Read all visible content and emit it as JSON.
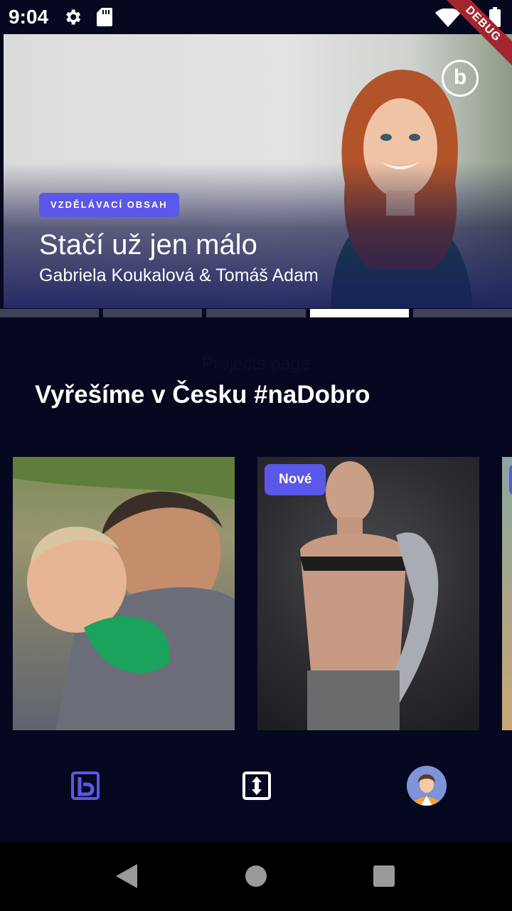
{
  "status_bar": {
    "time": "9:04",
    "debug_label": "DEBUG",
    "icons": [
      "gear-icon",
      "sd-card-icon",
      "wifi-icon",
      "battery-icon"
    ]
  },
  "hero": {
    "tag": "VZDĚLÁVACÍ OBSAH",
    "title": "Stačí už jen málo",
    "subtitle": "Gabriela Koukalová & Tomáš Adam",
    "logo_letter": "b",
    "slide_count": 5,
    "active_slide": 4
  },
  "page_label": "Projects page",
  "section_title": "Vyřešíme v Česku #naDobro",
  "projects": [
    {
      "badge": ""
    },
    {
      "badge": "Nové"
    },
    {
      "badge": ""
    }
  ],
  "bottom_nav": {
    "items": [
      "home-b-logo-icon",
      "sort-arrows-icon",
      "profile-avatar"
    ]
  },
  "colors": {
    "background": "#06081f",
    "accent": "#5b57e8",
    "debug_ribbon": "#a3262f"
  }
}
